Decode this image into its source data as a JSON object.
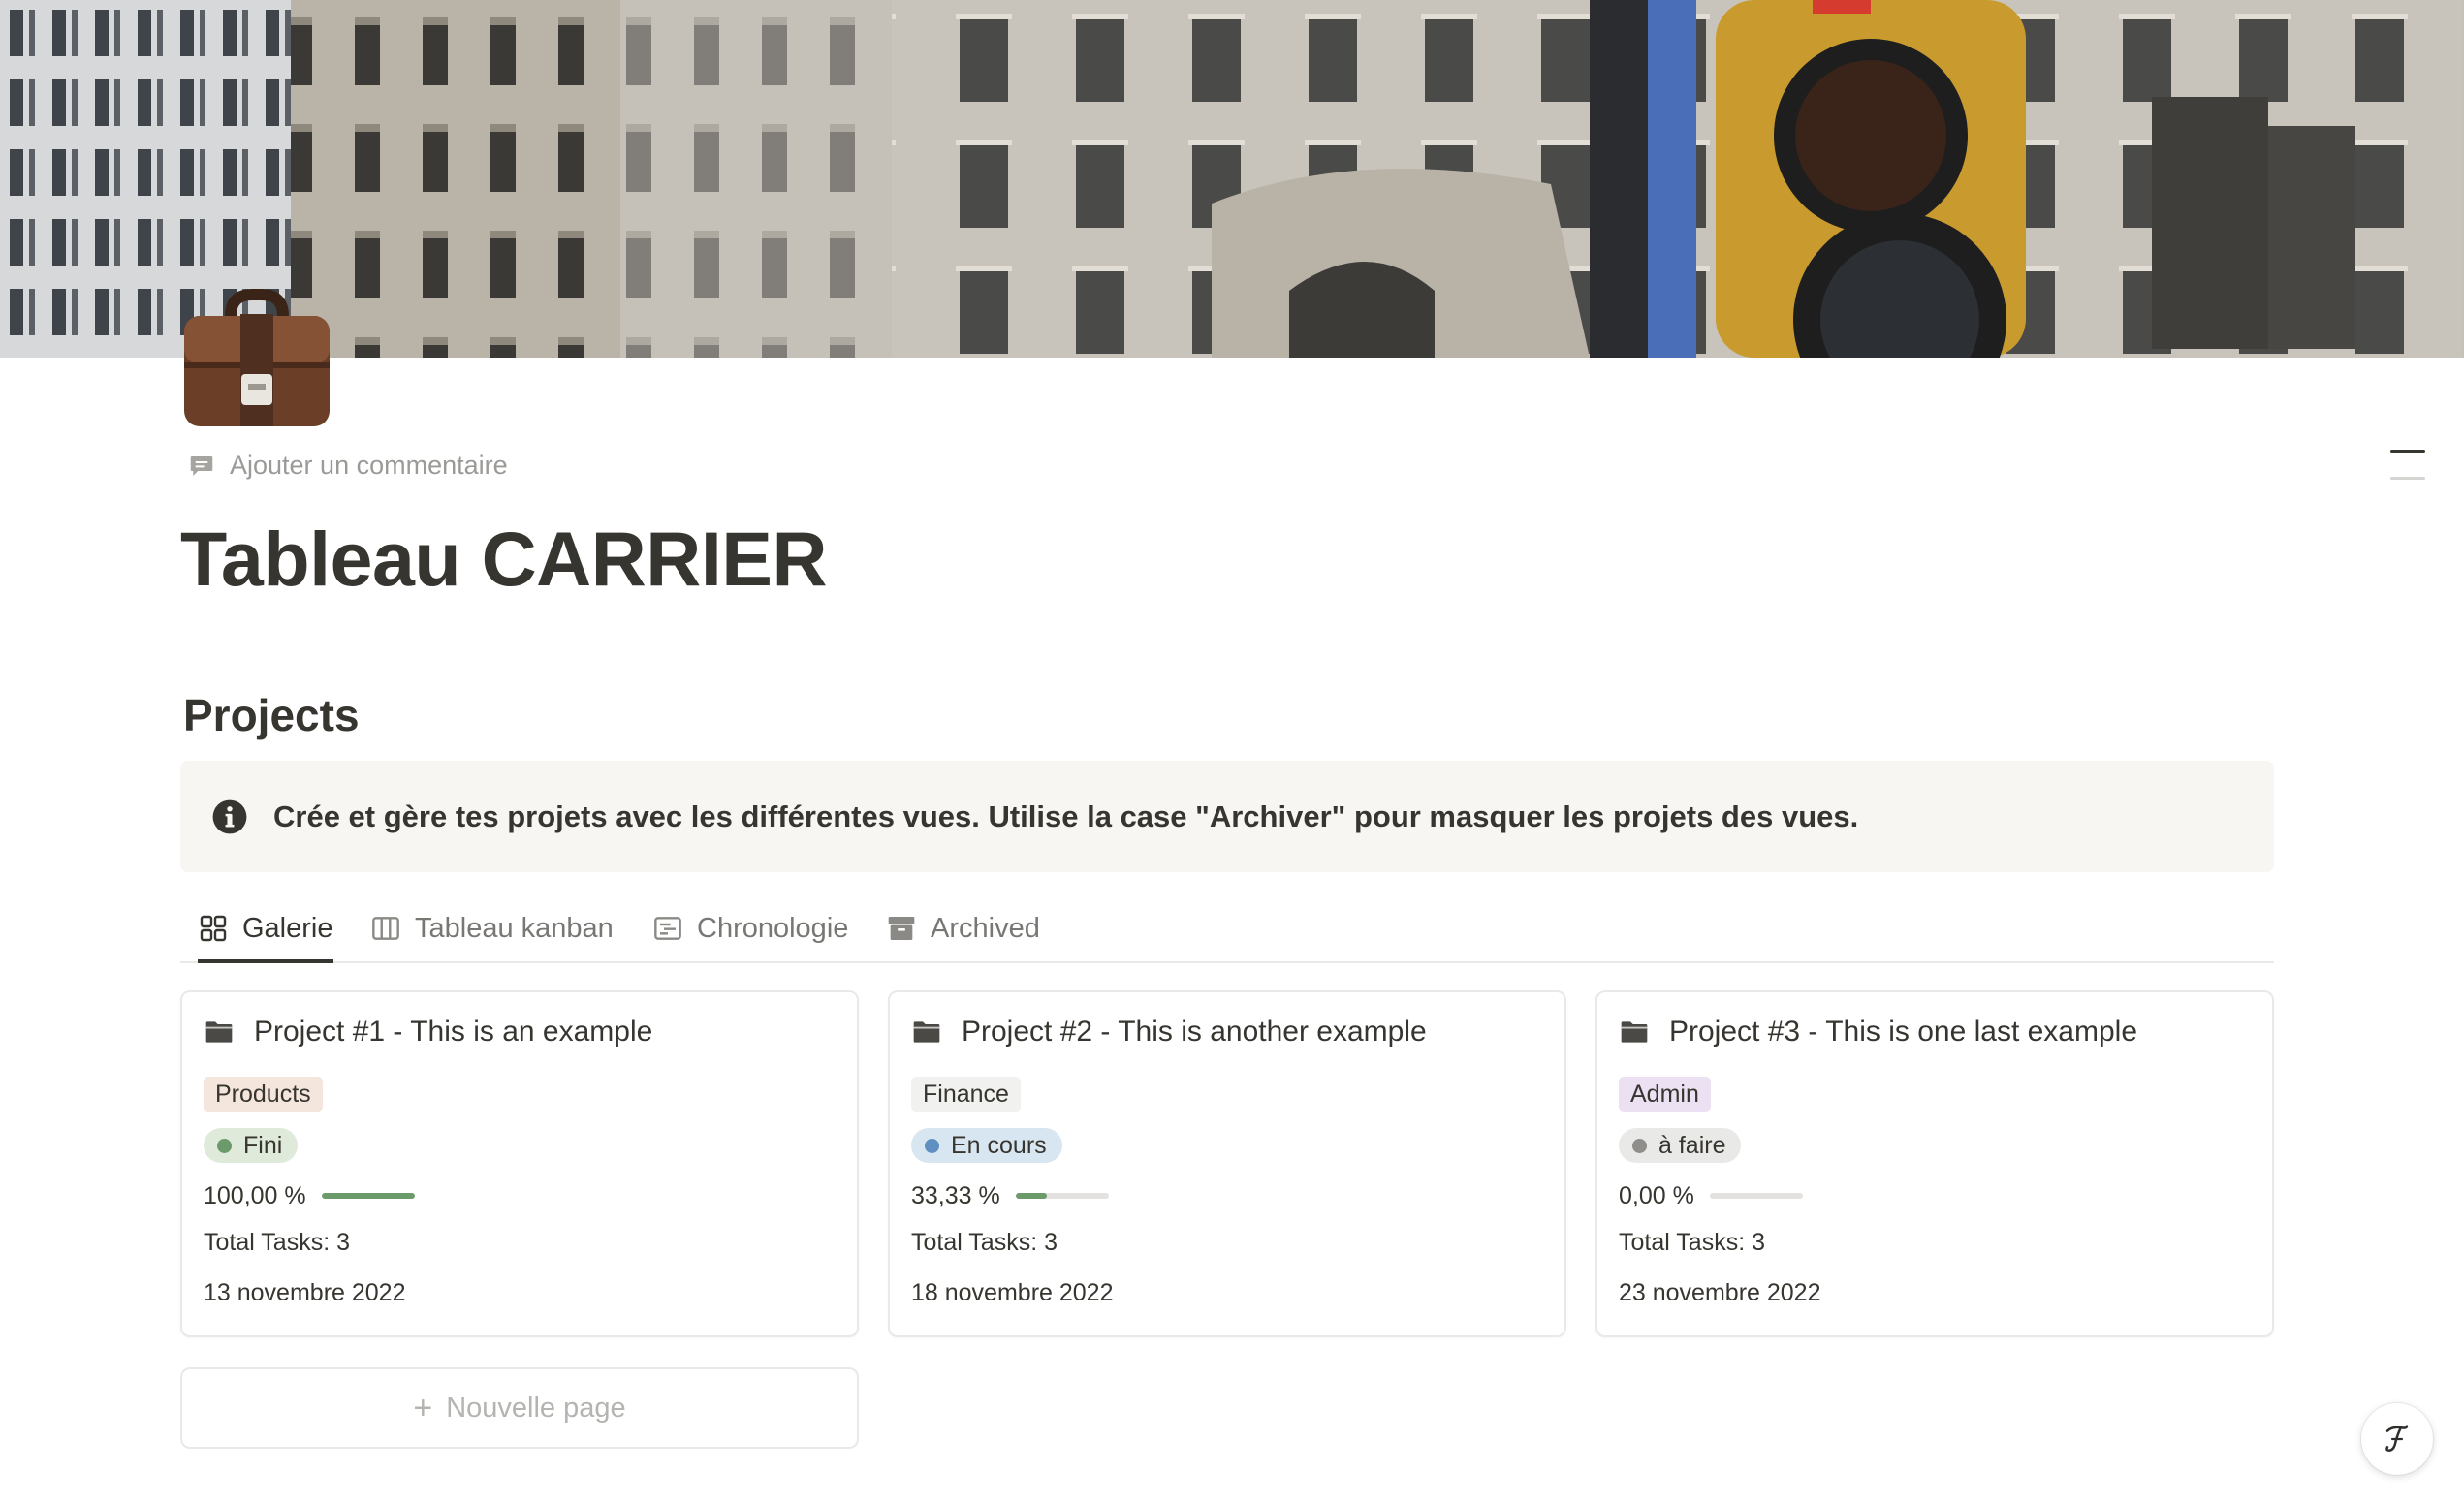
{
  "comment": {
    "label": "Ajouter un commentaire"
  },
  "page": {
    "title": "Tableau CARRIER"
  },
  "section": {
    "heading": "Projects"
  },
  "callout": {
    "text": "Crée et gère tes projets avec les différentes vues. Utilise la case \"Archiver\" pour masquer les projets des vues."
  },
  "tabs": [
    {
      "label": "Galerie",
      "icon": "gallery-icon",
      "active": true
    },
    {
      "label": "Tableau kanban",
      "icon": "board-icon",
      "active": false
    },
    {
      "label": "Chronologie",
      "icon": "timeline-icon",
      "active": false
    },
    {
      "label": "Archived",
      "icon": "archive-icon",
      "active": false
    }
  ],
  "cards": [
    {
      "title": "Project #1 - This is an example",
      "category": "Products",
      "category_bg": "#f4e5dd",
      "status": "Fini",
      "status_bg": "#dfeadb",
      "status_dot": "#6c9b6b",
      "progress_text": "100,00 %",
      "progress": 1.0,
      "progress_color": "#6c9b6b",
      "total": "Total Tasks: 3",
      "date": "13 novembre 2022"
    },
    {
      "title": "Project #2 - This is another example",
      "category": "Finance",
      "category_bg": "#f1f1ef",
      "status": "En cours",
      "status_bg": "#d8e6f2",
      "status_dot": "#5e8fc0",
      "progress_text": "33,33 %",
      "progress": 0.3333,
      "progress_color": "#6c9b6b",
      "total": "Total Tasks: 3",
      "date": "18 novembre 2022"
    },
    {
      "title": "Project #3 - This is one last example",
      "category": "Admin",
      "category_bg": "#ebe1f2",
      "status": "à faire",
      "status_bg": "#e9e9e7",
      "status_dot": "#8f8e8b",
      "progress_text": "0,00 %",
      "progress": 0.0,
      "progress_color": "#6c9b6b",
      "total": "Total Tasks: 3",
      "date": "23 novembre 2022"
    }
  ],
  "new_page": {
    "label": "Nouvelle page",
    "icon": "plus-icon"
  },
  "help": {
    "icon": "help-icon"
  },
  "colors": {
    "text": "#37352f",
    "muted": "#9b9a97",
    "callout_bg": "#f7f6f3",
    "border": "#e9e9e7"
  }
}
